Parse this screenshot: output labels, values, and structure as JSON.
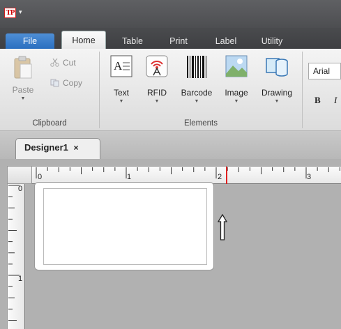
{
  "app": {
    "logo_text": "TP",
    "quick_access": "▾"
  },
  "tabs": [
    {
      "label": "File"
    },
    {
      "label": "Home"
    },
    {
      "label": "Table"
    },
    {
      "label": "Print"
    },
    {
      "label": "Label"
    },
    {
      "label": "Utility"
    }
  ],
  "clipboard": {
    "paste_label": "Paste",
    "cut_label": "Cut",
    "copy_label": "Copy",
    "group_label": "Clipboard"
  },
  "elements": {
    "text_label": "Text",
    "rfid_label": "RFID",
    "barcode_label": "Barcode",
    "image_label": "Image",
    "drawing_label": "Drawing",
    "group_label": "Elements"
  },
  "font": {
    "family_value": "Arial",
    "bold_label": "B",
    "italic_label": "I"
  },
  "document": {
    "tab_title": "Designer1",
    "close_glyph": "×"
  },
  "ruler": {
    "h_numbers": [
      "0",
      "1",
      "2",
      "3"
    ],
    "v_numbers": [
      "0",
      "1"
    ]
  },
  "colors": {
    "file_tab": "#2a6fbf",
    "ruler_marker": "#e02020",
    "workspace": "#b1b1b1"
  }
}
